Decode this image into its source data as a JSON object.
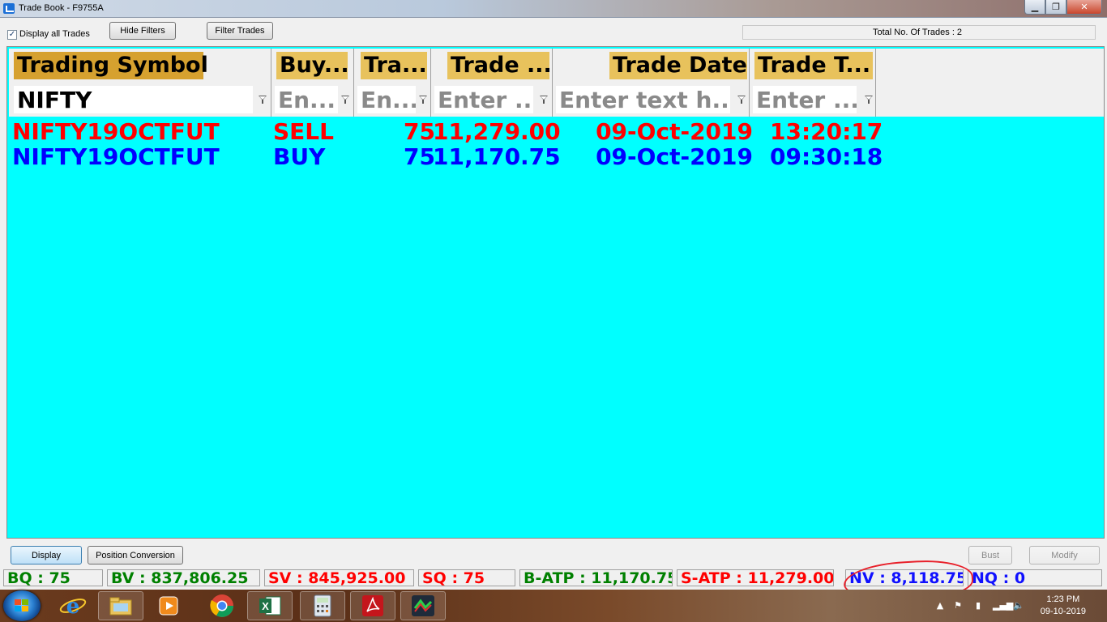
{
  "window": {
    "title": "Trade Book - F9755A",
    "minimize": "▁",
    "restore": "❐",
    "close": "✕"
  },
  "toolbar": {
    "display_all_trades_label": "Display all Trades",
    "display_all_trades_checked": true,
    "hide_filters_label": "Hide Filters",
    "filter_trades_label": "Filter Trades",
    "total_trades_text": "Total No. Of Trades : 2"
  },
  "grid": {
    "background_color": "#00ffff",
    "columns": [
      {
        "header": "Trading Symbol",
        "filter_value": "NIFTY",
        "filter_placeholder": ""
      },
      {
        "header": "Buy...",
        "filter_value": "",
        "filter_placeholder": "En..."
      },
      {
        "header": "Tra...",
        "filter_value": "",
        "filter_placeholder": "En..."
      },
      {
        "header": "Trade ...",
        "filter_value": "",
        "filter_placeholder": "Enter ..."
      },
      {
        "header": "Trade Date",
        "filter_value": "",
        "filter_placeholder": "Enter text h..."
      },
      {
        "header": "Trade T...",
        "filter_value": "",
        "filter_placeholder": "Enter ..."
      }
    ],
    "rows": [
      {
        "symbol": "NIFTY19OCTFUT",
        "side": "SELL",
        "qty": "75",
        "price": "11,279.00",
        "date": "09-Oct-2019",
        "time": "13:20:17",
        "color": "#ff0000"
      },
      {
        "symbol": "NIFTY19OCTFUT",
        "side": "BUY",
        "qty": "75",
        "price": "11,170.75",
        "date": "09-Oct-2019",
        "time": "09:30:18",
        "color": "#0000ff"
      }
    ]
  },
  "actions": {
    "display_label": "Display",
    "position_conversion_label": "Position Conversion",
    "bust_label": "Bust",
    "modify_label": "Modify"
  },
  "status": {
    "bq": "BQ : 75",
    "bv": "BV : 837,806.25",
    "sv": "SV : 845,925.00",
    "sq": "SQ : 75",
    "batp": "B-ATP : 11,170.75",
    "satp": "S-ATP : 11,279.00",
    "nv": "NV : 8,118.75",
    "nq": "NQ : 0",
    "highlight_color": "#e8202a"
  },
  "taskbar": {
    "apps": [
      "windows-explorer",
      "internet-explorer",
      "media-player",
      "chrome",
      "excel",
      "calculator",
      "acrobat-reader",
      "trading-app"
    ],
    "time": "1:23 PM",
    "date": "09-10-2019"
  }
}
